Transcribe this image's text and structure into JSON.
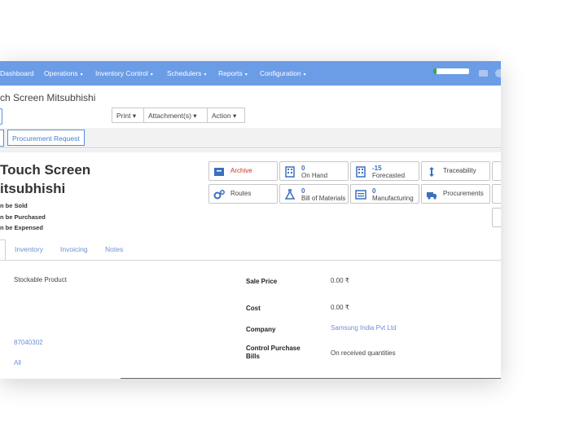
{
  "navbar": {
    "menu": [
      {
        "label": "Dashboard"
      },
      {
        "label": "Operations",
        "caret": "▾"
      },
      {
        "label": "Inventory Control",
        "caret": "▾"
      },
      {
        "label": "Schedulers",
        "caret": "▾"
      },
      {
        "label": "Reports",
        "caret": "▾"
      },
      {
        "label": "Configuration",
        "caret": "▾"
      }
    ],
    "progress_fraction": 0.08,
    "accent_color": "#6b9ce6"
  },
  "breadcrumb": "ch Screen Mitsubhishi",
  "toolbar": {
    "print_label": "Print ▾",
    "attachments_label": "Attachment(s) ▾",
    "action_label": "Action ▾"
  },
  "statusbar": {
    "procurement_request_label": "Procurement Request"
  },
  "product": {
    "title_line1": "Touch Screen",
    "title_line2": "itsubhishi",
    "flags": [
      "n be Sold",
      "n be Purchased",
      "n be Expensed"
    ]
  },
  "smart_buttons": {
    "archive": {
      "label": "Archive",
      "icon": "archive-icon"
    },
    "on_hand": {
      "value": "0",
      "label": "On Hand",
      "icon": "building-icon"
    },
    "forecasted": {
      "value": "-15",
      "label": "Forecasted",
      "icon": "building-icon"
    },
    "traceability": {
      "label": "Traceability",
      "icon": "updown-arrow-icon"
    },
    "routes": {
      "label": "Routes",
      "icon": "cogs-icon"
    },
    "bom": {
      "value": "0",
      "label": "Bill of Materials",
      "icon": "flask-icon"
    },
    "manufacturing": {
      "value": "0",
      "label": "Manufacturing",
      "icon": "list-icon"
    },
    "procurements": {
      "label": "Procurements",
      "icon": "truck-icon"
    }
  },
  "tabs": [
    {
      "label": "Inventory"
    },
    {
      "label": "Invoicing"
    },
    {
      "label": "Notes"
    }
  ],
  "form": {
    "product_type": "Stockable Product",
    "barcode": "87040302",
    "category": "All",
    "sale_price_label": "Sale Price",
    "sale_price": "0.00 ₹",
    "cost_label": "Cost",
    "cost": "0.00 ₹",
    "company_label": "Company",
    "company": "Samsung India Pvt Ltd",
    "control_label_line1": "Control Purchase",
    "control_label_line2": "Bills",
    "control_value": "On received quantities"
  }
}
